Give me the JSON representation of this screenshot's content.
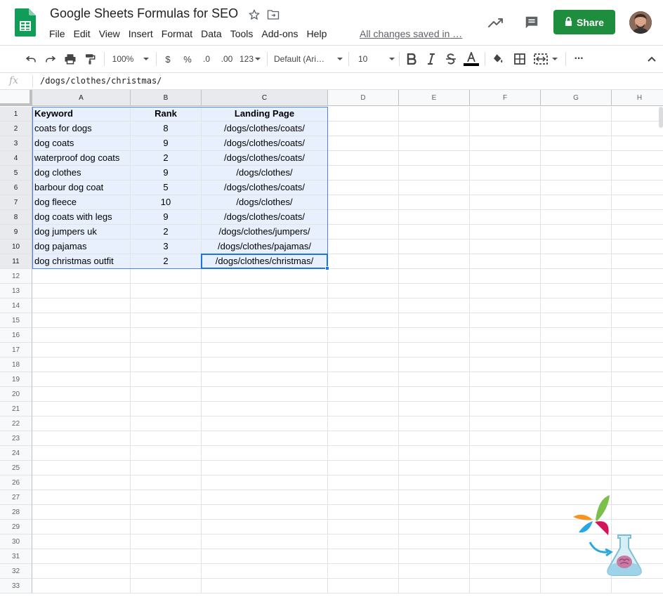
{
  "app": {
    "title": "Google Sheets Formulas for SEO",
    "menu": [
      "File",
      "Edit",
      "View",
      "Insert",
      "Format",
      "Data",
      "Tools",
      "Add-ons",
      "Help"
    ],
    "save_status": "All changes saved in …",
    "share_label": "Share"
  },
  "toolbar": {
    "zoom": "100%",
    "currency": "$",
    "percent": "%",
    "decrease_decimals": ".0",
    "increase_decimals": ".00",
    "more_formats": "123",
    "font": "Default (Ari…",
    "font_size": "10",
    "more": "···"
  },
  "formula_bar": {
    "fx": "fx",
    "value": "/dogs/clothes/christmas/"
  },
  "columns": [
    "A",
    "B",
    "C",
    "D",
    "E",
    "F",
    "G",
    "H"
  ],
  "row_count": 33,
  "sheet": {
    "header": [
      "Keyword",
      "Rank",
      "Landing Page"
    ],
    "rows": [
      [
        "coats for dogs",
        "8",
        "/dogs/clothes/coats/"
      ],
      [
        "dog coats",
        "9",
        "/dogs/clothes/coats/"
      ],
      [
        "waterproof dog coats",
        "2",
        "/dogs/clothes/coats/"
      ],
      [
        "dog clothes",
        "9",
        "/dogs/clothes/"
      ],
      [
        "barbour dog coat",
        "5",
        "/dogs/clothes/coats/"
      ],
      [
        "dog fleece",
        "10",
        "/dogs/clothes/"
      ],
      [
        "dog coats with legs",
        "9",
        "/dogs/clothes/coats/"
      ],
      [
        "dog jumpers uk",
        "2",
        "/dogs/clothes/jumpers/"
      ],
      [
        "dog pajamas",
        "3",
        "/dogs/clothes/pajamas/"
      ],
      [
        "dog christmas outfit",
        "2",
        "/dogs/clothes/christmas/"
      ]
    ]
  },
  "selection": {
    "active_cell": "C11",
    "range": "A1:C11"
  },
  "colors": {
    "share_green": "#1e8e3e",
    "selection_blue": "#1a73e8",
    "range_fill": "#e8f0fe",
    "sheets_green": "#0f9d58"
  },
  "icons": [
    "sheets-logo-icon",
    "star-icon",
    "folder-move-icon",
    "trending-icon",
    "comment-icon",
    "lock-icon",
    "undo-icon",
    "redo-icon",
    "print-icon",
    "paint-format-icon",
    "bold-icon",
    "italic-icon",
    "strikethrough-icon",
    "text-color-icon",
    "fill-color-icon",
    "borders-icon",
    "merge-cells-icon",
    "collapse-toolbar-icon"
  ]
}
